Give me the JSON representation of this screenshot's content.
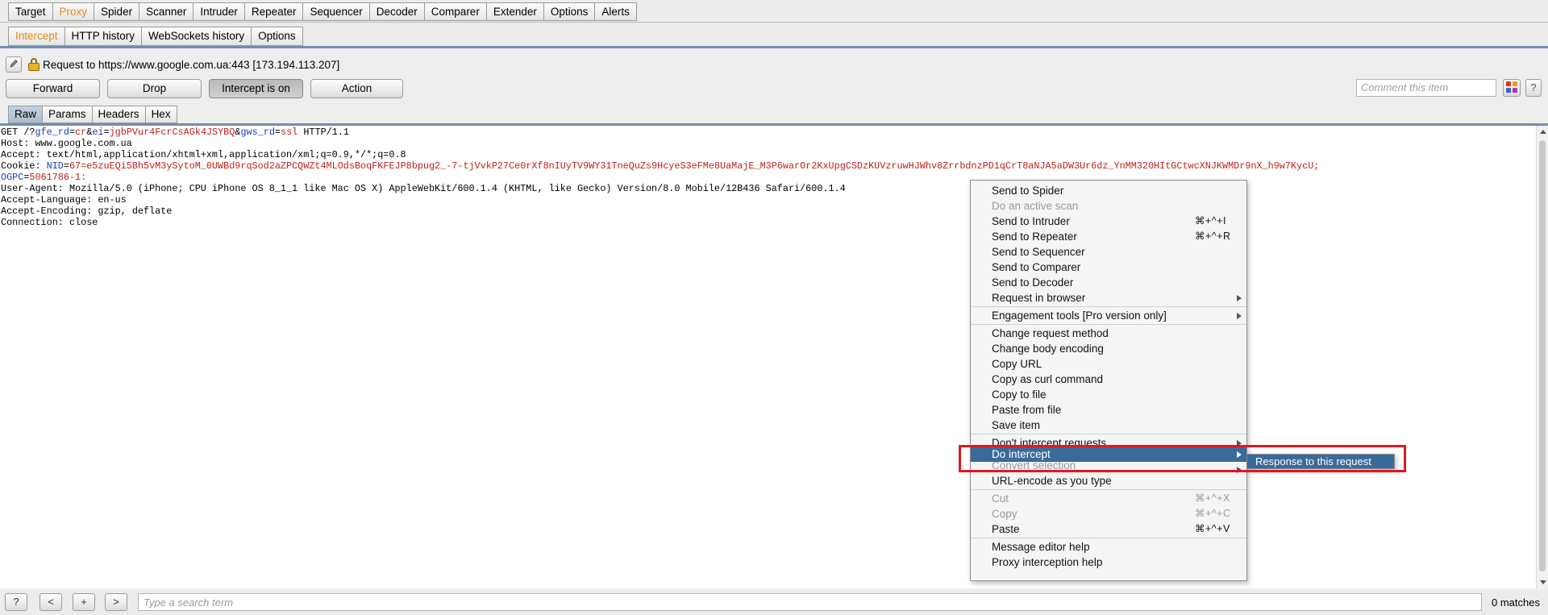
{
  "main_tabs": [
    "Target",
    "Proxy",
    "Spider",
    "Scanner",
    "Intruder",
    "Repeater",
    "Sequencer",
    "Decoder",
    "Comparer",
    "Extender",
    "Options",
    "Alerts"
  ],
  "proxy_tabs": [
    "Intercept",
    "HTTP history",
    "WebSockets history",
    "Options"
  ],
  "request_info": {
    "text": "Request to https://www.google.com.ua:443  [173.194.113.207]"
  },
  "buttons": {
    "forward": "Forward",
    "drop": "Drop",
    "intercept": "Intercept is on",
    "action": "Action"
  },
  "comment": {
    "placeholder": "Comment this item"
  },
  "help_label": "?",
  "view_tabs": [
    "Raw",
    "Params",
    "Headers",
    "Hex"
  ],
  "request": {
    "line1_prefix": "GET /?",
    "p1_name": "gfe_rd",
    "p1_val": "cr",
    "p2_name": "ei",
    "p2_val": "jgbPVur4FcrCsAGk4JSYBQ",
    "p3_name": "gws_rd",
    "p3_val": "ssl",
    "line1_suffix": " HTTP/1.1",
    "host": "Host: www.google.com.ua",
    "accept": "Accept: text/html,application/xhtml+xml,application/xml;q=0.9,*/*;q=0.8",
    "cookie_label": "Cookie: ",
    "cookie1_name": "NID",
    "cookie1_val": "67=e5zuEQi5Bh5vM3ySytoM_0UWBd9rqSod2aZPCQWZt4MLOdsBoqFKFEJP8bpug2_-7-tjVvkP27Ce0rXf8nIUyTV9WY31TneQuZs9HcyeS3eFMe8UaMajE_M3P6warOr2KxUpgCSDzKUVzruwHJWhv8ZrrbdnzPD1qCrT8aNJA5aDW3Ur6dz_YnMM320HItGCtwcXNJKWMDr9nX_h9w7KycU;",
    "cookie2_name": "OGPC",
    "cookie2_val": "5061786-1:",
    "user_agent": "User-Agent: Mozilla/5.0 (iPhone; CPU iPhone OS 8_1_1 like Mac OS X) AppleWebKit/600.1.4 (KHTML, like Gecko) Version/8.0 Mobile/12B436 Safari/600.1.4",
    "accept_language": "Accept-Language: en-us",
    "accept_encoding": "Accept-Encoding: gzip, deflate",
    "connection": "Connection: close"
  },
  "context_menu": {
    "send_to_spider": "Send to Spider",
    "active_scan": "Do an active scan",
    "send_to_intruder": "Send to Intruder",
    "send_to_intruder_sc": "⌘+^+I",
    "send_to_repeater": "Send to Repeater",
    "send_to_repeater_sc": "⌘+^+R",
    "send_to_sequencer": "Send to Sequencer",
    "send_to_comparer": "Send to Comparer",
    "send_to_decoder": "Send to Decoder",
    "request_in_browser": "Request in browser",
    "engagement_tools": "Engagement tools [Pro version only]",
    "change_method": "Change request method",
    "change_encoding": "Change body encoding",
    "copy_url": "Copy URL",
    "copy_curl": "Copy as curl command",
    "copy_to_file": "Copy to file",
    "paste_from_file": "Paste from file",
    "save_item": "Save item",
    "dont_intercept": "Don't intercept requests",
    "do_intercept": "Do intercept",
    "convert_selection": "Convert selection",
    "url_encode": "URL-encode as you type",
    "cut": "Cut",
    "cut_sc": "⌘+^+X",
    "copy": "Copy",
    "copy_sc": "⌘+^+C",
    "paste": "Paste",
    "paste_sc": "⌘+^+V",
    "editor_help": "Message editor help",
    "proxy_help": "Proxy interception help"
  },
  "submenu": {
    "response": "Response to this request"
  },
  "footer": {
    "help": "?",
    "prev": "<",
    "add": "+",
    "next": ">",
    "search_placeholder": "Type a search term",
    "matches": "0 matches"
  },
  "colors": {
    "accent_tab": "#e58a16",
    "menu_highlight": "#3a6a9a",
    "annotation": "#e4161f",
    "param_name": "#1a39c4",
    "param_value": "#c0211b"
  }
}
